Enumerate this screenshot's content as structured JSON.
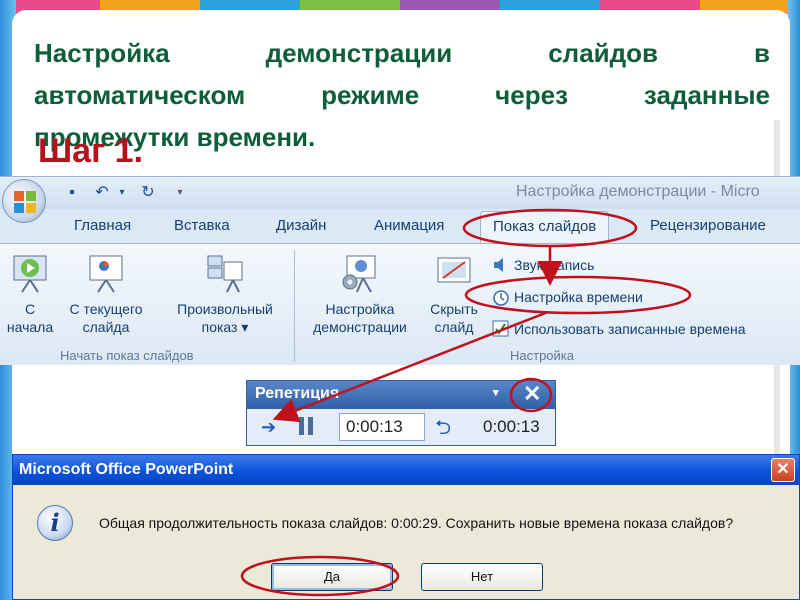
{
  "slide": {
    "title_lines": [
      "Настройка демонстрации слайдов в",
      "автоматическом режиме через заданные",
      "промежутки времени."
    ],
    "step": "Шаг 1."
  },
  "ribbon": {
    "window_title": "Настройка демонстрации - Micro",
    "tabs": [
      "Главная",
      "Вставка",
      "Дизайн",
      "Анимация",
      "Показ слайдов",
      "Рецензирование"
    ],
    "active_tab": "Показ слайдов",
    "group_start": {
      "label": "Начать показ слайдов",
      "buttons": [
        {
          "line1": "С",
          "line2": "начала",
          "icon": "play-from-start-icon"
        },
        {
          "line1": "С текущего",
          "line2": "слайда",
          "icon": "play-current-icon"
        },
        {
          "line1": "Произвольный",
          "line2": "показ ▾",
          "icon": "custom-show-icon"
        }
      ]
    },
    "group_setup": {
      "label": "Настройка",
      "buttons": [
        {
          "line1": "Настройка",
          "line2": "демонстрации",
          "icon": "setup-show-icon"
        },
        {
          "line1": "Скрыть",
          "line2": "слайд",
          "icon": "hide-slide-icon"
        }
      ],
      "small_buttons": [
        {
          "label": "Звукозапись",
          "icon": "record-narration-icon"
        },
        {
          "label": "Настройка времени",
          "icon": "rehearse-timings-icon"
        },
        {
          "label": "Использовать записанные времена",
          "icon": "checkbox-icon",
          "checked": true
        }
      ]
    }
  },
  "rehearsal": {
    "title": "Репетиция",
    "dropdown": "▾",
    "close": "✕",
    "slide_time": "0:00:13",
    "total_time": "0:00:13"
  },
  "dialog": {
    "title": "Microsoft Office PowerPoint",
    "close": "✕",
    "message": "Общая продолжительность показа слайдов: 0:00:29. Сохранить новые времена показа слайдов?",
    "yes_label": "Да",
    "no_label": "Нет"
  },
  "colors": {
    "title_green": "#0f5e3a",
    "step_red": "#b5121b",
    "annotation_red": "#c0121c"
  }
}
